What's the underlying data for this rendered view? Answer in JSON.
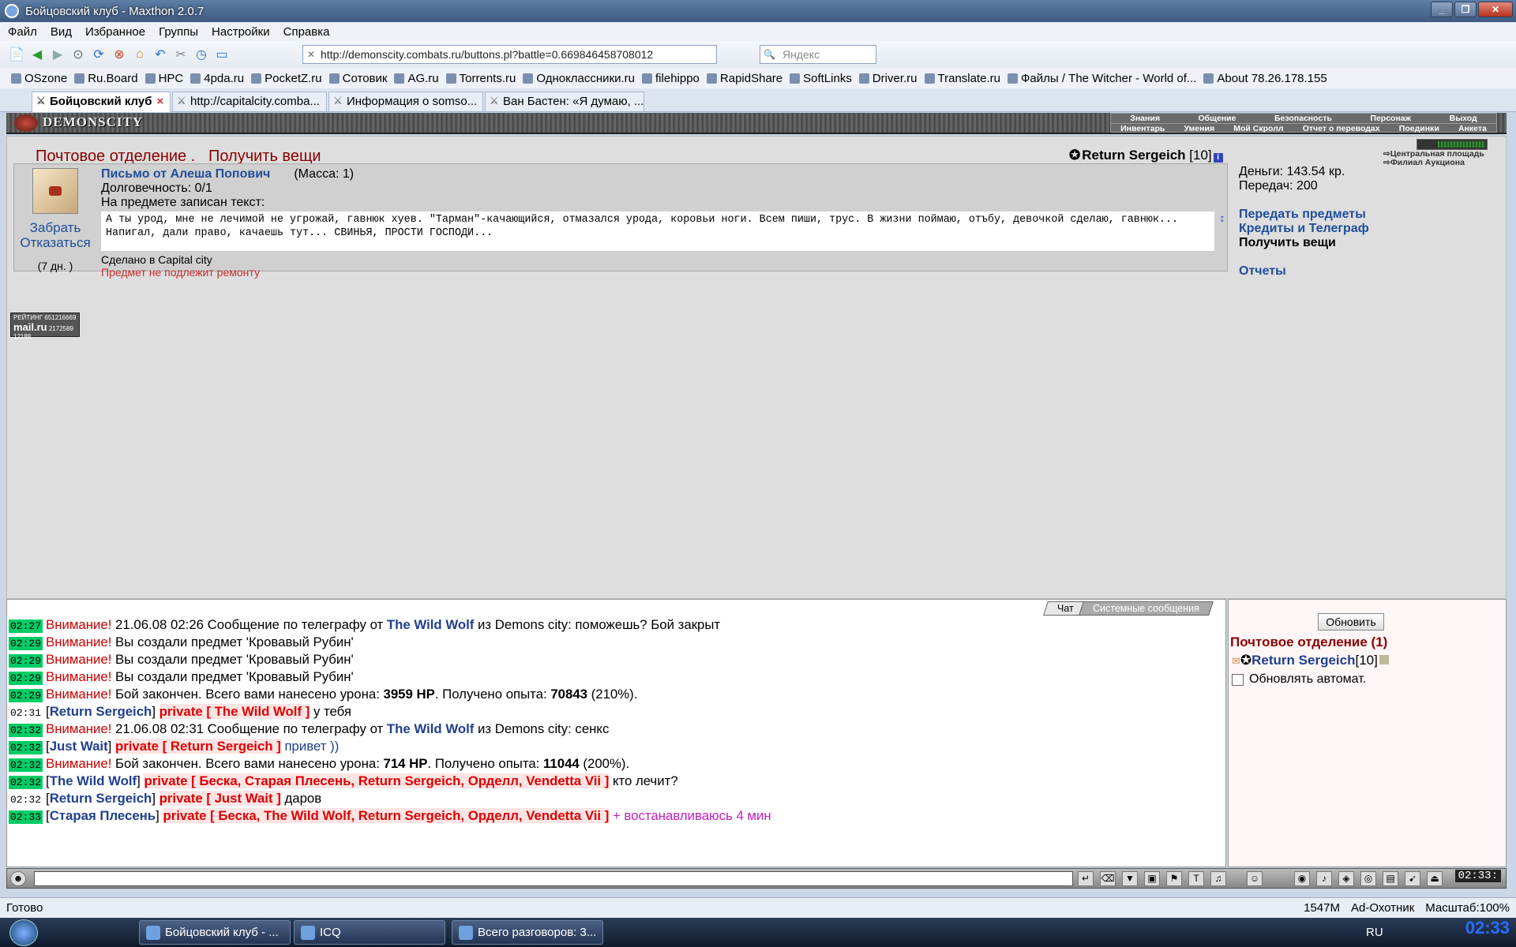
{
  "window": {
    "title": "Бойцовский клуб - Maxthon 2.0.7"
  },
  "menu": [
    "Файл",
    "Вид",
    "Избранное",
    "Группы",
    "Настройки",
    "Справка"
  ],
  "toolbar": {
    "address": "http://demonscity.combats.ru/buttons.pl?battle=0.669846458708012",
    "search_placeholder": "Яндекс"
  },
  "bookmarks": [
    "OSzone",
    "Ru.Board",
    "HPC",
    "4pda.ru",
    "PocketZ.ru",
    "Сотовик",
    "AG.ru",
    "Torrents.ru",
    "Одноклассники.ru",
    "filehippo",
    "RapidShare",
    "SoftLinks",
    "Driver.ru",
    "Translate.ru",
    "Файлы / The Witcher - World of...",
    "About 78.26.178.155"
  ],
  "tabs": [
    {
      "label": "Бойцовский клуб",
      "active": true
    },
    {
      "label": "http://capitalcity.comba...",
      "active": false
    },
    {
      "label": "Информация о somso...",
      "active": false
    },
    {
      "label": "Ван Бастен: «Я думаю, ...",
      "active": false
    }
  ],
  "game": {
    "logo": "DEMONSCITY",
    "nav_top": [
      "Знания",
      "Общение",
      "Безопасность",
      "Персонаж",
      "Выход"
    ],
    "nav_bottom": [
      "Инвентарь",
      "Умения",
      "Мой Скролл",
      "Отчет о переводах",
      "Поединки",
      "Анкета"
    ]
  },
  "post": {
    "heading": "Почтовое отделение .   Получить вещи",
    "user": "Return Sergeich",
    "user_level": "[10]",
    "item": {
      "title": "Письмо от Алеша Попович",
      "mass": "(Масса: 1)",
      "durability": "Долговечность: 0/1",
      "text_label": "На предмете записан текст:",
      "text": "А ты урод, мне не лечимой не угрожай, гавнюк хуев. \"Тарман\"-качающийся, отмазался урода, коровьи ноги. Всем пиши, трус. В жизни поймаю, отъбу, девочкой сделаю, гавнюк... Напигал, дали право, качаешь тут... СВИНЬЯ, ПРОСТИ ГОСПОДИ...",
      "made_in": "Сделано в Capital city",
      "no_repair": "Предмет не подлежит ремонту",
      "take": "Забрать",
      "refuse": "Отказаться",
      "days": "(7 дн. )"
    },
    "location": [
      "Центральная площадь",
      "Филиал Аукциона"
    ],
    "money": "Деньги: 143.54 кр.",
    "transfers": "Передач: 200",
    "links": [
      "Передать предметы",
      "Кредиты и Телеграф",
      "Получить вещи"
    ],
    "reports": "Отчеты",
    "counter": {
      "top": "РЕЙТИНГ 651216669",
      "brand": "mail.ru",
      "n1": "2172589",
      "n2": "12188"
    }
  },
  "chat": {
    "tabs": [
      "Чат",
      "Системные сообщения"
    ],
    "lines": [
      {
        "time": "02:27",
        "hl": true,
        "parts": [
          [
            "warn",
            "Внимание! "
          ],
          [
            "",
            "21.06.08 02:26 Сообщение по телеграфу от "
          ],
          [
            "nick",
            "The Wild Wolf"
          ],
          [
            "",
            " из Demons city: поможешь? Бой закрыт"
          ]
        ]
      },
      {
        "time": "02:29",
        "hl": true,
        "parts": [
          [
            "warn",
            "Внимание! "
          ],
          [
            "",
            "Вы создали предмет 'Кровавый Рубин'"
          ]
        ]
      },
      {
        "time": "02:29",
        "hl": true,
        "parts": [
          [
            "warn",
            "Внимание! "
          ],
          [
            "",
            "Вы создали предмет 'Кровавый Рубин'"
          ]
        ]
      },
      {
        "time": "02:29",
        "hl": true,
        "parts": [
          [
            "warn",
            "Внимание! "
          ],
          [
            "",
            "Вы создали предмет 'Кровавый Рубин'"
          ]
        ]
      },
      {
        "time": "02:29",
        "hl": true,
        "parts": [
          [
            "warn",
            "Внимание! "
          ],
          [
            "",
            "Бой закончен. Всего вами нанесено урона: "
          ],
          [
            "b",
            "3959 HP"
          ],
          [
            "",
            ". Получено опыта: "
          ],
          [
            "b",
            "70843"
          ],
          [
            "",
            " (210%)."
          ]
        ]
      },
      {
        "time": "02:31",
        "hl": false,
        "parts": [
          [
            "",
            "["
          ],
          [
            "nick",
            "Return Sergeich"
          ],
          [
            "",
            "] "
          ],
          [
            "priv",
            "private [ The Wild Wolf ]"
          ],
          [
            "",
            " у тебя"
          ]
        ]
      },
      {
        "time": "02:32",
        "hl": true,
        "parts": [
          [
            "warn",
            "Внимание! "
          ],
          [
            "",
            "21.06.08 02:31 Сообщение по телеграфу от "
          ],
          [
            "nick",
            "The Wild Wolf"
          ],
          [
            "",
            " из Demons city: сенкс"
          ]
        ]
      },
      {
        "time": "02:32",
        "hl": true,
        "parts": [
          [
            "",
            "["
          ],
          [
            "nick",
            "Just Wait"
          ],
          [
            "",
            "] "
          ],
          [
            "priv",
            "private [ Return Sergeich ]"
          ],
          [
            "blue",
            " привет ))"
          ]
        ]
      },
      {
        "time": "02:32",
        "hl": true,
        "parts": [
          [
            "warn",
            "Внимание! "
          ],
          [
            "",
            "Бой закончен. Всего вами нанесено урона: "
          ],
          [
            "b",
            "714 HP"
          ],
          [
            "",
            ". Получено опыта: "
          ],
          [
            "b",
            "11044"
          ],
          [
            "",
            " (200%)."
          ]
        ]
      },
      {
        "time": "02:32",
        "hl": true,
        "parts": [
          [
            "",
            "["
          ],
          [
            "nick",
            "The Wild Wolf"
          ],
          [
            "",
            "] "
          ],
          [
            "priv",
            "private [ Беска, Старая Плесень, Return Sergeich, Орделл, Vendetta Vii ]"
          ],
          [
            "",
            " кто лечит?"
          ]
        ]
      },
      {
        "time": "02:32",
        "hl": false,
        "parts": [
          [
            "",
            "["
          ],
          [
            "nick",
            "Return Sergeich"
          ],
          [
            "",
            "] "
          ],
          [
            "priv",
            "private [ Just Wait ]"
          ],
          [
            "",
            " даров"
          ]
        ]
      },
      {
        "time": "02:33",
        "hl": true,
        "parts": [
          [
            "",
            "["
          ],
          [
            "nick",
            "Старая Плесень"
          ],
          [
            "",
            "] "
          ],
          [
            "priv",
            "private [ Беска, The Wild Wolf, Return Sergeich, Орделл, Vendetta Vii ]"
          ],
          [
            "purple",
            " + востанавливаюсь 4 мин"
          ]
        ]
      }
    ]
  },
  "online": {
    "refresh": "Обновить",
    "title": "Почтовое отделение (1)",
    "user": "Return Sergeich",
    "user_level": "[10]",
    "auto": "Обновлять автомат."
  },
  "input_clock": "02:33:",
  "status": {
    "left": "Готово",
    "memory": "1547M",
    "adblock": "Ad-Охотник",
    "zoom": "Масштаб:100%"
  },
  "taskbar": {
    "buttons": [
      "Бойцовский клуб - ...",
      "ICQ",
      "Всего разговоров: 3..."
    ],
    "lang": "RU",
    "time": "02:33"
  }
}
